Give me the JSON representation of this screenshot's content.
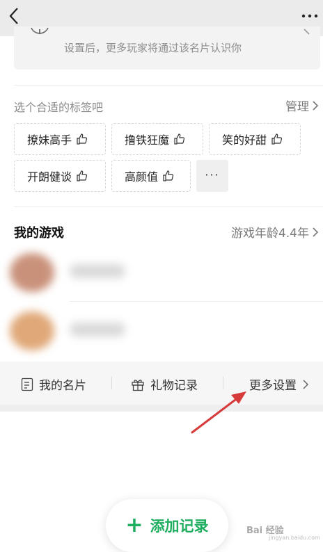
{
  "tip": {
    "text": "设置后，更多玩家将通过该名片认识你"
  },
  "tags": {
    "title": "选个合适的标签吧",
    "manage_label": "管理",
    "items": [
      "撩妹高手",
      "撸铁狂魔",
      "笑的好甜",
      "开朗健谈",
      "高颜值"
    ],
    "more_label": "···"
  },
  "games": {
    "title": "我的游戏",
    "age_label": "游戏年龄4.4年"
  },
  "footer": {
    "card_label": "我的名片",
    "gift_label": "礼物记录",
    "settings_label": "更多设置"
  },
  "add_button": {
    "plus": "+",
    "label": "添加记录"
  },
  "watermark": {
    "text": "Bai 经验",
    "sub": "jingyan.baidu.com"
  },
  "colors": {
    "accent_green": "#1fad5f",
    "arrow_red": "#d63a3a"
  },
  "icons": [
    "back-chevron-icon",
    "more-dots-icon",
    "info-icon",
    "chevron-right-icon",
    "thumbs-up-icon",
    "name-card-icon",
    "gift-icon",
    "annotation-arrow"
  ]
}
